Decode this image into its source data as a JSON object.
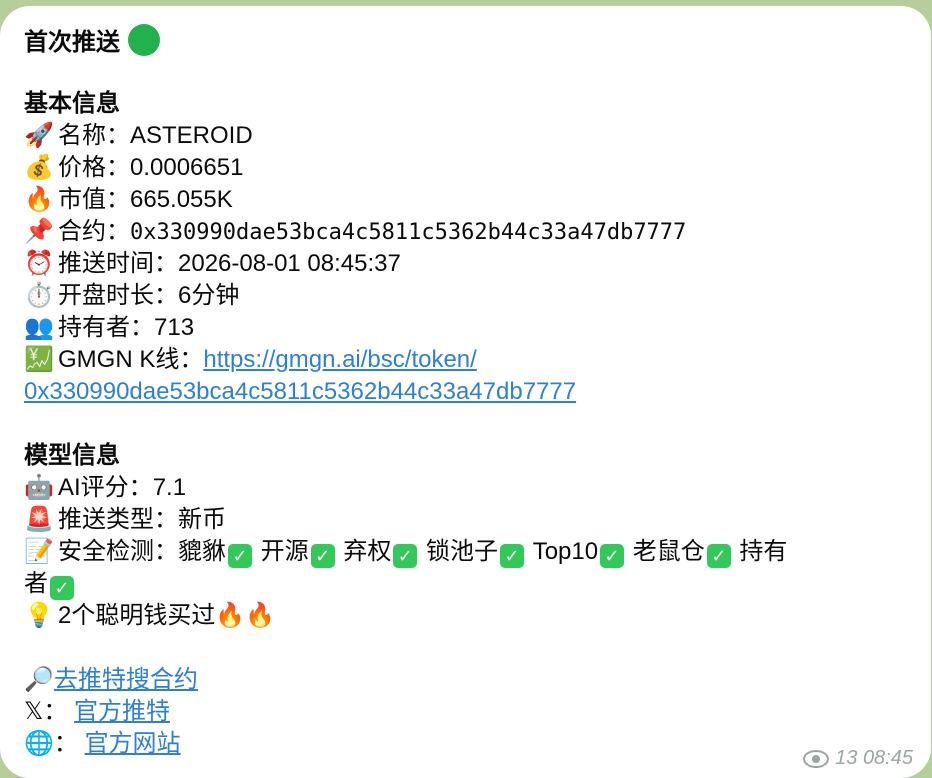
{
  "title": "首次推送",
  "sections": {
    "basic": {
      "heading": "基本信息",
      "name_label": "名称：",
      "name_value": "ASTEROID",
      "price_label": "价格：",
      "price_value": "0.0006651",
      "mcap_label": "市值：",
      "mcap_value": "665.055K",
      "contract_label": "合约：",
      "contract_value": "0x330990dae53bca4c5811c5362b44c33a47db7777",
      "time_label": "推送时间：",
      "time_value": "2026-08-01 08:45:37",
      "open_label": "开盘时长：",
      "open_value": "6分钟",
      "holders_label": "持有者：",
      "holders_value": "713",
      "gmgn_label": "GMGN K线：",
      "gmgn_link_part1": "https://gmgn.ai/bsc/token/",
      "gmgn_link_part2": "0x330990dae53bca4c5811c5362b44c33a47db7777"
    },
    "model": {
      "heading": "模型信息",
      "ai_label": "AI评分：",
      "ai_value": "7.1",
      "type_label": "推送类型：",
      "type_value": "新币",
      "security_label": "安全检测：",
      "checks": [
        "貔貅",
        "开源",
        "弃权",
        "锁池子",
        "Top10",
        "老鼠仓",
        "持有",
        "者"
      ],
      "smart_money": "2个聪明钱买过"
    },
    "links": {
      "twitter_search": "去推特搜合约",
      "x_label": "𝕏：",
      "official_twitter": "官方推特",
      "web_label": "：",
      "official_site": "官方网站"
    }
  },
  "meta": {
    "views": "13",
    "time": "08:45"
  },
  "icons": {
    "status": "green-circle-icon",
    "accent_link": "#2f7fd3",
    "check_color": "#34c759"
  }
}
